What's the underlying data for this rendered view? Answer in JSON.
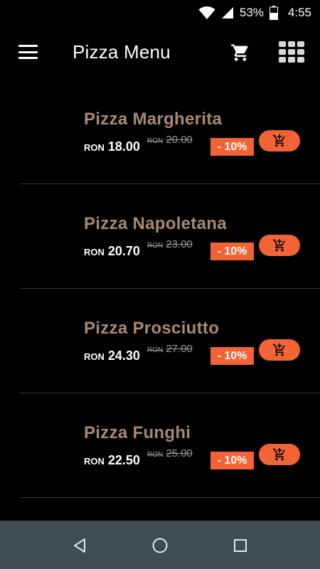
{
  "status_bar": {
    "battery_percent": "53%",
    "time": "4:55"
  },
  "app_bar": {
    "title": "Pizza Menu"
  },
  "colors": {
    "accent": "#f26435",
    "product_name": "#a98a70",
    "nav_bar": "#414b52",
    "background": "#000000"
  },
  "items": [
    {
      "name": "Pizza Margherita",
      "currency": "RON",
      "price": "18.00",
      "old_price": "20.00",
      "discount": "- 10%"
    },
    {
      "name": "Pizza Napoletana",
      "currency": "RON",
      "price": "20.70",
      "old_price": "23.00",
      "discount": "- 10%"
    },
    {
      "name": "Pizza Prosciutto",
      "currency": "RON",
      "price": "24.30",
      "old_price": "27.00",
      "discount": "- 10%"
    },
    {
      "name": "Pizza Funghi",
      "currency": "RON",
      "price": "22.50",
      "old_price": "25.00",
      "discount": "- 10%"
    }
  ]
}
